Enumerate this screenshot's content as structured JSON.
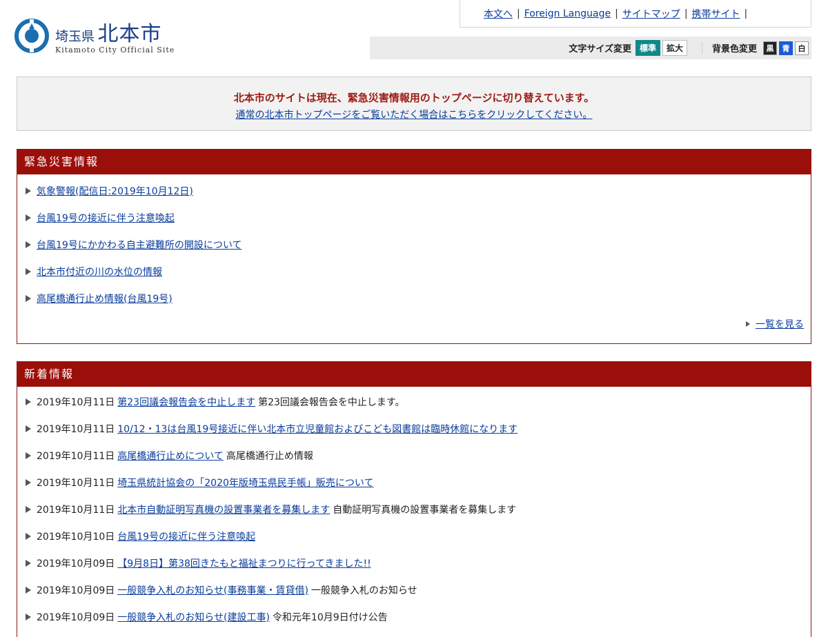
{
  "logo": {
    "prefecture": "埼玉県",
    "city": "北本市",
    "subtitle": "Kitamoto City Official Site"
  },
  "toplinks": [
    {
      "label": "本文へ"
    },
    {
      "label": "Foreign Language"
    },
    {
      "label": "サイトマップ"
    },
    {
      "label": "携帯サイト"
    }
  ],
  "toplink_separator": "|",
  "toolbar": {
    "font_size_label": "文字サイズ変更",
    "font_standard": "標準",
    "font_large": "拡大",
    "bg_color_label": "背景色変更",
    "bg_black": "黒",
    "bg_blue": "青",
    "bg_white": "白"
  },
  "notice": {
    "message": "北本市のサイトは現在、緊急災害情報用のトップページに切り替えています。",
    "link": "通常の北本市トップページをご覧いただく場合はこちらをクリックしてください。"
  },
  "emergency": {
    "title": "緊急災害情報",
    "items": [
      {
        "label": "気象警報(配信日:2019年10月12日)"
      },
      {
        "label": "台風19号の接近に伴う注意喚起"
      },
      {
        "label": "台風19号にかかわる自主避難所の開設について"
      },
      {
        "label": "北本市付近の川の水位の情報"
      },
      {
        "label": "高尾橋通行止め情報(台風19号)"
      }
    ],
    "more": "一覧を見る"
  },
  "news": {
    "title": "新着情報",
    "items": [
      {
        "date": "2019年10月11日",
        "link": "第23回議会報告会を中止します",
        "desc": "第23回議会報告会を中止します。"
      },
      {
        "date": "2019年10月11日",
        "link": "10/12・13は台風19号接近に伴い北本市立児童館およびこども図書館は臨時休館になります",
        "desc": ""
      },
      {
        "date": "2019年10月11日",
        "link": "高尾橋通行止めについて",
        "desc": "高尾橋通行止め情報"
      },
      {
        "date": "2019年10月11日",
        "link": "埼玉県統計協会の「2020年版埼玉県民手帳」販売について",
        "desc": ""
      },
      {
        "date": "2019年10月11日",
        "link": "北本市自動証明写真機の設置事業者を募集します",
        "desc": "自動証明写真機の設置事業者を募集します"
      },
      {
        "date": "2019年10月10日",
        "link": "台風19号の接近に伴う注意喚起",
        "desc": ""
      },
      {
        "date": "2019年10月09日",
        "link": "【9月8日】第38回きたもと福祉まつりに行ってきました!!",
        "desc": ""
      },
      {
        "date": "2019年10月09日",
        "link": "一般競争入札のお知らせ(事務事業・賃貸借)",
        "desc": "一般競争入札のお知らせ"
      },
      {
        "date": "2019年10月09日",
        "link": "一般競争入札のお知らせ(建設工事)",
        "desc": "令和元年10月9日付け公告"
      }
    ]
  },
  "colors": {
    "accent": "#9b0f0a",
    "link": "#0a3c9b",
    "active_button": "#118888"
  }
}
